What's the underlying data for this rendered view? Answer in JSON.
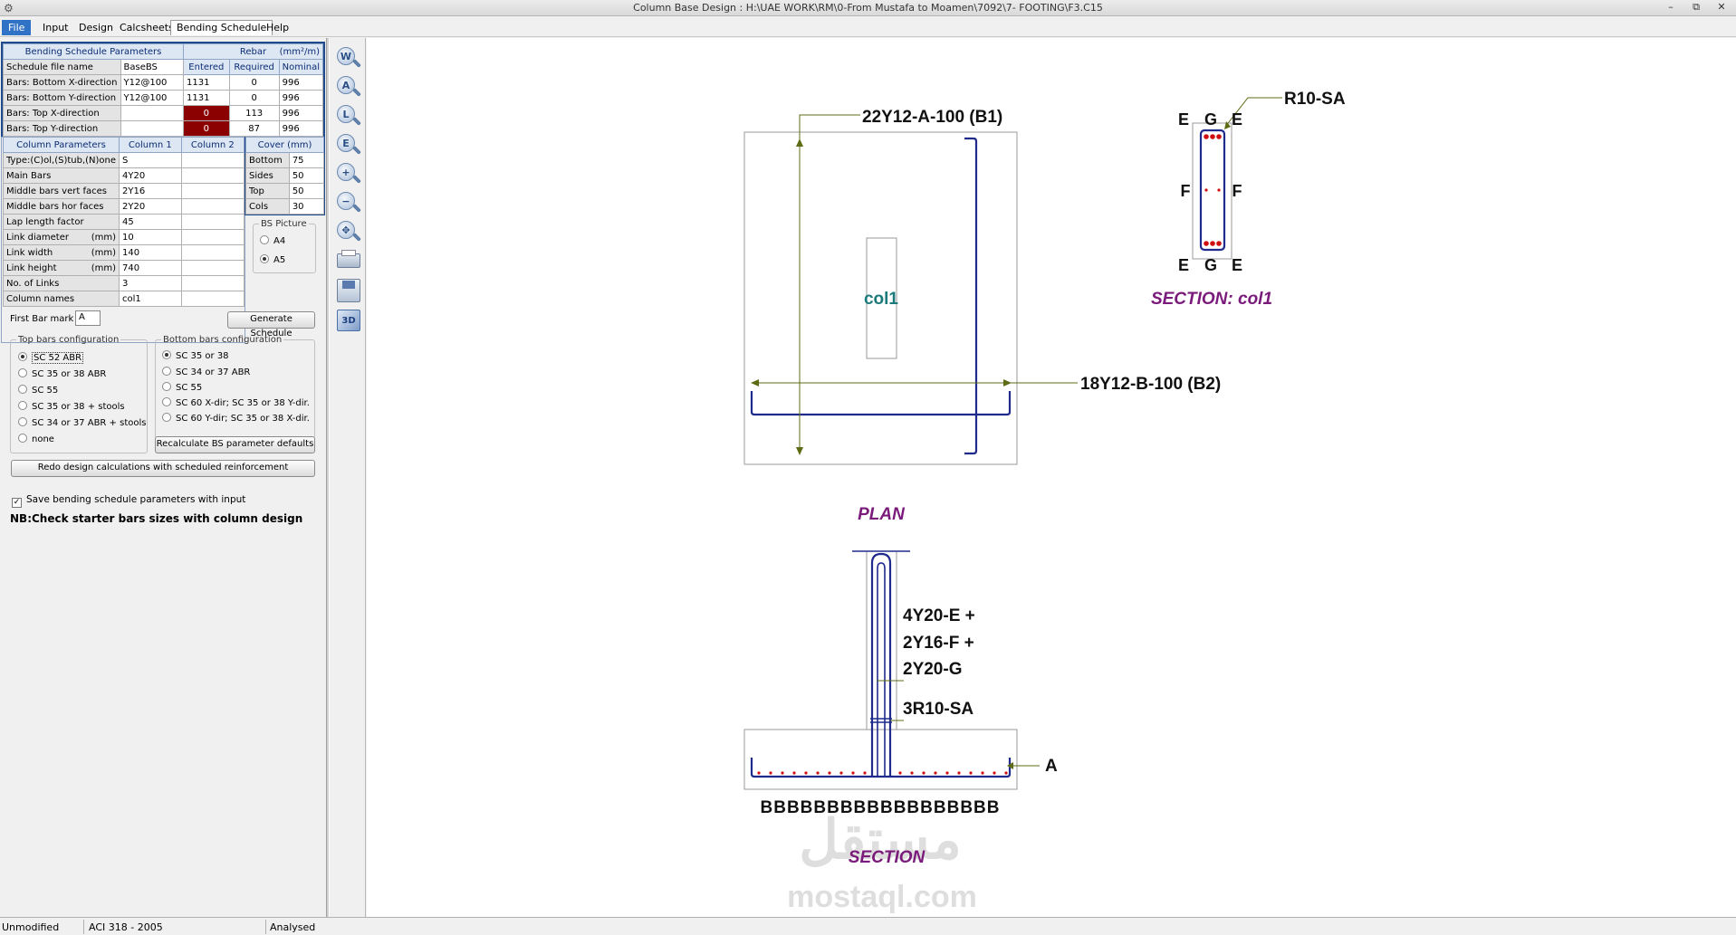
{
  "window": {
    "title": "Column Base Design :  H:\\UAE WORK\\RM\\0-From Mustafa to Moamen\\7092\\7- FOOTING\\F3.C15",
    "minimize": "–",
    "restore": "⧉",
    "close": "✕"
  },
  "menu": [
    "File",
    "Input",
    "Design",
    "Calcsheets",
    "Bending Schedule",
    "Help"
  ],
  "bs_params": {
    "title": "Bending Schedule Parameters",
    "rebar_title": "Rebar",
    "rebar_unit": "(mm²/m)",
    "col_entered": "Entered",
    "col_required": "Required",
    "col_nominal": "Nominal",
    "rows": [
      {
        "label": "Schedule file name",
        "value": "BaseBS",
        "entered": "",
        "required": "",
        "nominal": ""
      },
      {
        "label": "Bars: Bottom X-direction",
        "value": "Y12@100",
        "entered": "1131",
        "required": "0",
        "nominal": "996"
      },
      {
        "label": "Bars: Bottom Y-direction",
        "value": "Y12@100",
        "entered": "1131",
        "required": "0",
        "nominal": "996"
      },
      {
        "label": "Bars: Top X-direction",
        "value": "",
        "entered": "0",
        "required": "113",
        "nominal": "996"
      },
      {
        "label": "Bars: Top Y-direction",
        "value": "",
        "entered": "0",
        "required": "87",
        "nominal": "996"
      }
    ]
  },
  "col_params": {
    "title": "Column Parameters",
    "col1": "Column 1",
    "col2": "Column 2",
    "rows": [
      {
        "label": "Type:(C)ol,(S)tub,(N)one",
        "unit": "",
        "v1": "S"
      },
      {
        "label": "Main Bars",
        "unit": "",
        "v1": "4Y20"
      },
      {
        "label": "Middle bars vert faces",
        "unit": "",
        "v1": "2Y16"
      },
      {
        "label": "Middle bars hor faces",
        "unit": "",
        "v1": "2Y20"
      },
      {
        "label": "Lap length factor",
        "unit": "",
        "v1": "45"
      },
      {
        "label": "Link diameter",
        "unit": "(mm)",
        "v1": "10"
      },
      {
        "label": "Link width",
        "unit": "(mm)",
        "v1": "140"
      },
      {
        "label": "Link height",
        "unit": "(mm)",
        "v1": "740"
      },
      {
        "label": "No. of Links",
        "unit": "",
        "v1": "3"
      },
      {
        "label": "Column names",
        "unit": "",
        "v1": "col1"
      }
    ]
  },
  "cover": {
    "title": "Cover (mm)",
    "rows": [
      {
        "label": "Bottom",
        "value": "75"
      },
      {
        "label": "Sides",
        "value": "50"
      },
      {
        "label": "Top",
        "value": "50"
      },
      {
        "label": "Cols",
        "value": "30"
      }
    ]
  },
  "bs_picture": {
    "title": "BS Picture",
    "options": [
      "A4",
      "A5"
    ],
    "selected": "A5"
  },
  "first_bar_mark": {
    "label": "First Bar mark",
    "value": "A"
  },
  "generate_label": "Generate Schedule",
  "top_config": {
    "title": "Top bars configuration",
    "options": [
      "SC 52 ABR",
      "SC 35 or 38 ABR",
      "SC 55",
      "SC 35 or 38 + stools",
      "SC 34 or 37 ABR  + stools",
      "none"
    ],
    "selected": "SC 52 ABR"
  },
  "bottom_config": {
    "title": "Bottom bars configuration",
    "options": [
      "SC 35 or 38",
      "SC 34 or 37 ABR",
      "SC 55",
      "SC 60 X-dir; SC 35 or 38 Y-dir.",
      "SC 60 Y-dir; SC 35 or 38 X-dir."
    ],
    "selected": "SC 35 or 38"
  },
  "recalc_label": "Recalculate BS parameter defaults",
  "redo_label": "Redo design calculations with scheduled reinforcement",
  "save_params": {
    "label": "Save bending schedule parameters with input",
    "checked": true
  },
  "note": "NB:Check starter bars sizes with column design",
  "toolbar_icons": [
    "zoom-w-icon",
    "zoom-a-icon",
    "zoom-l-icon",
    "zoom-e-icon",
    "zoom-in-icon",
    "zoom-out-icon",
    "pan-icon",
    "print-icon",
    "save-icon",
    "3d-icon"
  ],
  "toolbar_letters": [
    "W",
    "A",
    "L",
    "E",
    "+",
    "−",
    "✥",
    "",
    "",
    "3D"
  ],
  "drawing": {
    "plan": {
      "b1_label": "22Y12-A-100 (B1)",
      "b2_label": "18Y12-B-100 (B2)",
      "column_label": "col1",
      "title": "PLAN"
    },
    "col_section": {
      "link_label": "R10-SA",
      "top_labels": [
        "E",
        "G",
        "E"
      ],
      "mid_labels": [
        "F",
        "F"
      ],
      "bottom_labels": [
        "E",
        "G",
        "E"
      ],
      "title": "SECTION: col1"
    },
    "section": {
      "bar_labels": [
        "4Y20-E +",
        "2Y16-F +",
        "2Y20-G"
      ],
      "link_label": "3R10-SA",
      "top_mark": "A",
      "bottom_marks": "BBBBBBBBBBBBBBBBBB",
      "title": "SECTION"
    },
    "watermark": {
      "arabic": "مستقل",
      "latin": "mostaql.com"
    },
    "colors": {
      "rebar": "#1f2a8c",
      "leader": "#5c6b14",
      "dot": "#d01010",
      "title": "#7a1a7a",
      "col_label": "#1a7a7a"
    }
  },
  "status": {
    "modified": "Unmodified",
    "code": "ACI 318 - 2005",
    "state": "Analysed"
  }
}
